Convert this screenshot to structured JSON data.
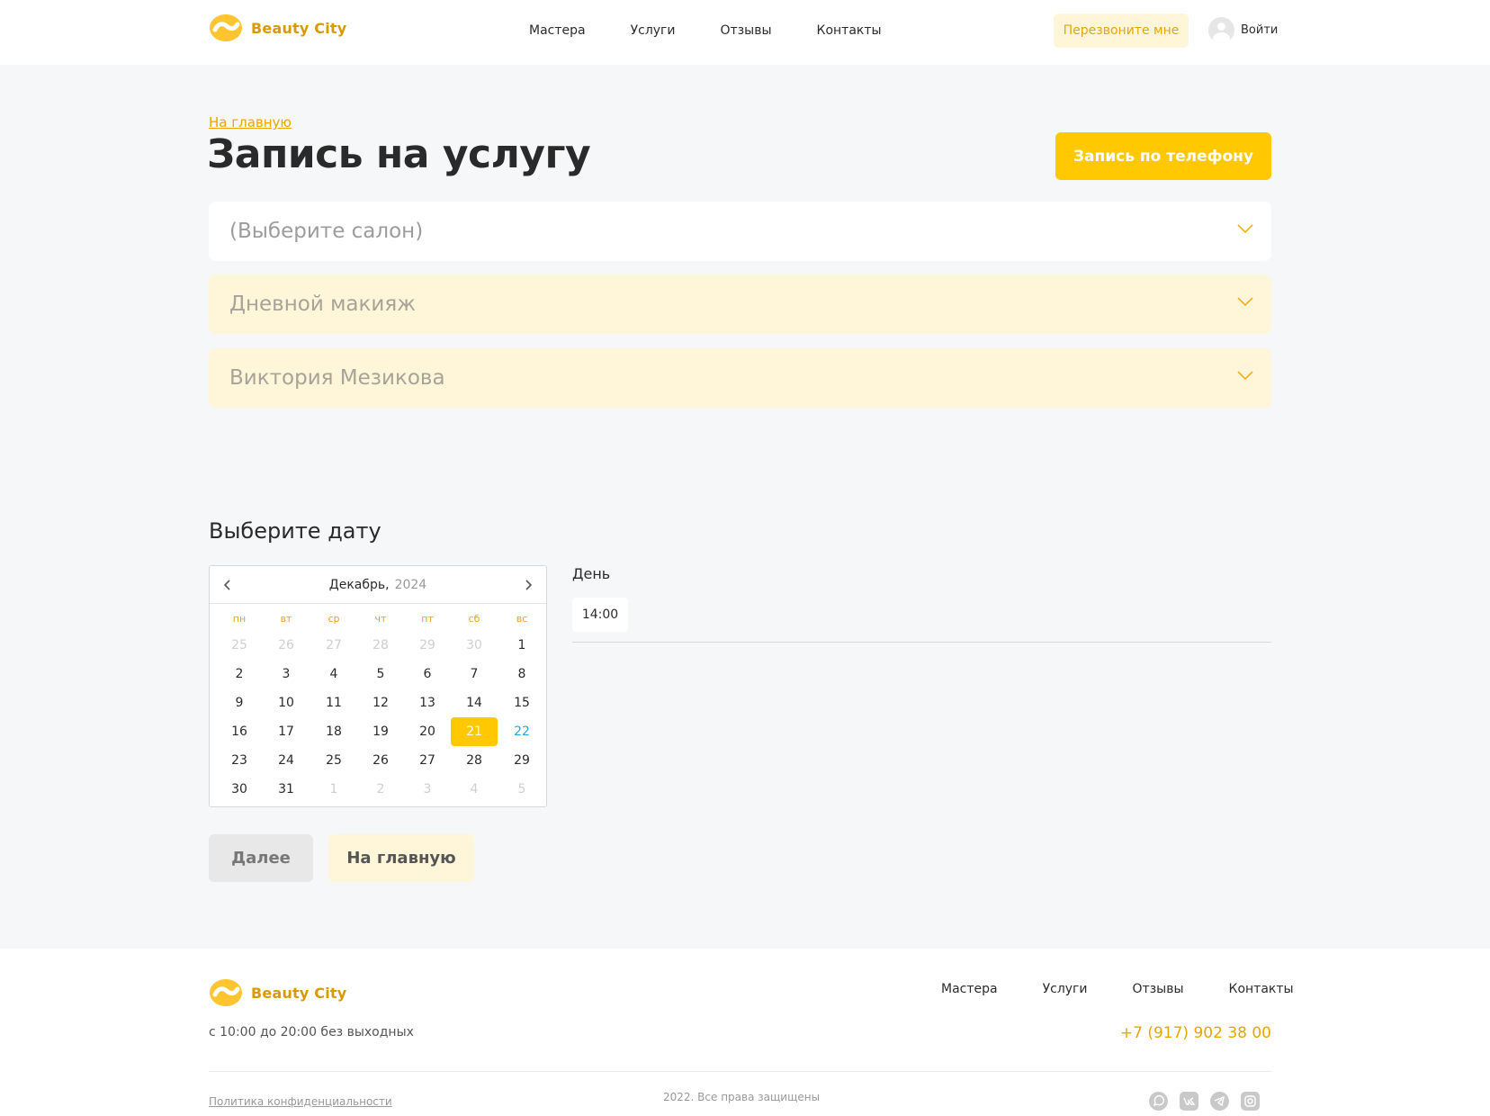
{
  "header": {
    "logo_text": "Beauty City",
    "nav": [
      "Мастера",
      "Услуги",
      "Отзывы",
      "Контакты"
    ],
    "callback_label": "Перезвоните мне",
    "login_label": "Войти"
  },
  "breadcrumb": "На главную",
  "page_title": "Запись на услугу",
  "phone_booking_label": "Запись по телефону",
  "selects": {
    "salon": "(Выберите салон)",
    "service": "Дневной макияж",
    "master": "Виктория Мезикова"
  },
  "date_section": {
    "heading": "Выберите дату",
    "calendar": {
      "month": "Декабрь,",
      "year": "2024",
      "weekdays": [
        "пн",
        "вт",
        "ср",
        "чт",
        "пт",
        "сб",
        "вс"
      ],
      "days": [
        [
          "25",
          "26",
          "27",
          "28",
          "29",
          "30",
          "1"
        ],
        [
          "2",
          "3",
          "4",
          "5",
          "6",
          "7",
          "8"
        ],
        [
          "9",
          "10",
          "11",
          "12",
          "13",
          "14",
          "15"
        ],
        [
          "16",
          "17",
          "18",
          "19",
          "20",
          "21",
          "22"
        ],
        [
          "23",
          "24",
          "25",
          "26",
          "27",
          "28",
          "29"
        ],
        [
          "30",
          "31",
          "1",
          "2",
          "3",
          "4",
          "5"
        ]
      ],
      "selected_day": "21",
      "highlighted_day": "22"
    },
    "day_label": "День",
    "time_slots": [
      "14:00"
    ]
  },
  "actions": {
    "next_label": "Далее",
    "home_label": "На главную"
  },
  "footer": {
    "logo_text": "Beauty City",
    "nav": [
      "Мастера",
      "Услуги",
      "Отзывы",
      "Контакты"
    ],
    "hours": "с 10:00 до 20:00 без выходных",
    "phone": "+7 (917) 902 38 00",
    "privacy": "Политика конфиденциальности",
    "rights": "2022. Все права защищены",
    "socials": [
      "whatsapp-icon",
      "vk-icon",
      "telegram-icon",
      "instagram-icon"
    ]
  },
  "colors": {
    "accent": "#ffc800",
    "accent_light": "#fff5d8",
    "accent_text": "#e5a600",
    "sunday": "#2aa3e0"
  }
}
